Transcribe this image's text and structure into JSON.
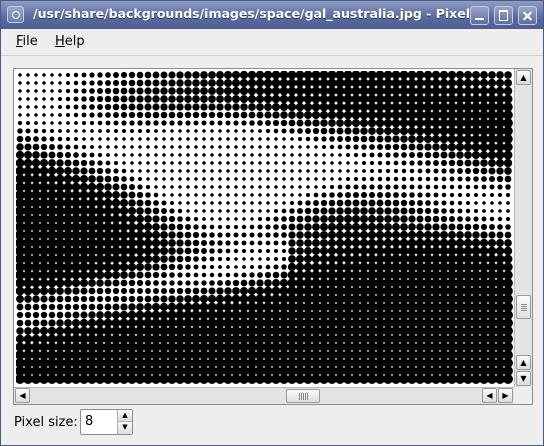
{
  "window": {
    "title": "/usr/share/backgrounds/images/space/gal_australia.jpg - Pixelator"
  },
  "menubar": {
    "file": {
      "accel": "F",
      "rest": "ile"
    },
    "help": {
      "accel": "H",
      "rest": "elp"
    }
  },
  "controls": {
    "pixel_size_label": "Pixel size:",
    "pixel_size_value": "8"
  },
  "icons": {
    "scroll_up": "▲",
    "scroll_down": "▼",
    "scroll_left": "◀",
    "scroll_right": "▶",
    "spin_up": "▲",
    "spin_down": "▼"
  }
}
